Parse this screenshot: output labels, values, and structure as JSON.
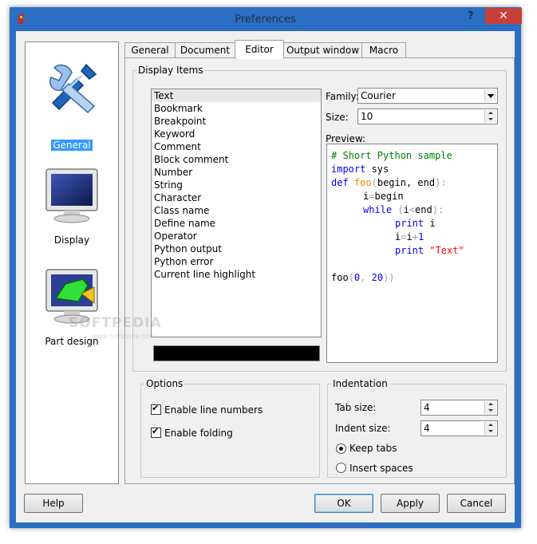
{
  "window": {
    "title": "Preferences",
    "help_glyph": "?",
    "close_glyph": "✕"
  },
  "sidebar": {
    "items": [
      {
        "label": "General",
        "icon": "tools-icon",
        "selected": true
      },
      {
        "label": "Display",
        "icon": "monitor-icon",
        "selected": false
      },
      {
        "label": "Part design",
        "icon": "part-design-icon",
        "selected": false
      }
    ]
  },
  "tabs": [
    "General",
    "Document",
    "Editor",
    "Output window",
    "Macro"
  ],
  "active_tab": "Editor",
  "display_items": {
    "group_label": "Display Items",
    "items": [
      "Text",
      "Bookmark",
      "Breakpoint",
      "Keyword",
      "Comment",
      "Block comment",
      "Number",
      "String",
      "Character",
      "Class name",
      "Define name",
      "Operator",
      "Python output",
      "Python error",
      "Current line highlight"
    ],
    "selected": "Text",
    "color_swatch": "#000000"
  },
  "font": {
    "family_label": "Family:",
    "family_value": "Courier",
    "size_label": "Size:",
    "size_value": "10",
    "preview_label": "Preview:"
  },
  "preview": {
    "line1": "# Short Python sample",
    "kw_import": "import",
    "module": " sys",
    "kw_def": "def",
    "func": "foo",
    "params_open": "(",
    "params": "begin, end",
    "params_close": "):",
    "assign_var": "i",
    "assign_op": "=",
    "assign_val": "begin",
    "kw_while": "while",
    "while_open": " (",
    "while_var": "i",
    "while_op": "<",
    "while_end": "end",
    "while_close": "):",
    "kw_print1": "print",
    "print_var": " i",
    "inc_var": "i",
    "inc_op1": "=",
    "inc_expr": "i",
    "inc_op2": "+",
    "inc_num": "1",
    "kw_print2": "print",
    "print_str": " \"Text\"",
    "call_name": "foo",
    "call_open": "(",
    "call_arg1": "0",
    "call_sep": ", ",
    "call_arg2": "20",
    "call_close": "))"
  },
  "options": {
    "group_label": "Options",
    "line_numbers": {
      "label": "Enable line numbers",
      "checked": true
    },
    "folding": {
      "label": "Enable folding",
      "checked": true
    }
  },
  "indentation": {
    "group_label": "Indentation",
    "tab_size_label": "Tab size:",
    "tab_size_value": "4",
    "indent_size_label": "Indent size:",
    "indent_size_value": "4",
    "keep_tabs": "Keep tabs",
    "insert_spaces": "Insert spaces",
    "selected": "Keep tabs"
  },
  "buttons": {
    "help": "Help",
    "ok": "OK",
    "apply": "Apply",
    "cancel": "Cancel"
  },
  "watermark": {
    "brand": "SOFTPEDIA",
    "url": "www.softpedia.com"
  },
  "colors": {
    "title_bar": "#2b6fc4",
    "close_button": "#c7413a",
    "selection": "#3399ff"
  }
}
